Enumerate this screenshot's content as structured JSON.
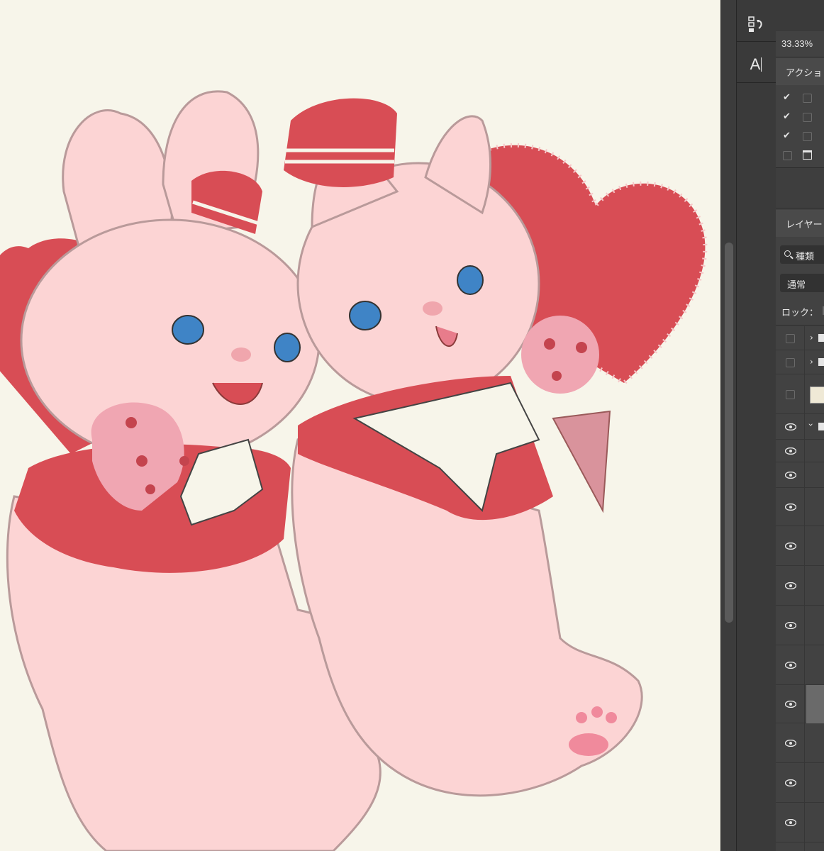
{
  "app": {
    "zoom_level": "33.33%"
  },
  "actions_panel": {
    "title": "アクショ",
    "items": [
      {
        "checked": true
      },
      {
        "checked": true
      },
      {
        "checked": true
      },
      {
        "checked": false
      }
    ]
  },
  "layers_panel": {
    "title": "レイヤー",
    "filter_label": "種類",
    "blend_mode": "通常",
    "lock_label": "ロック：",
    "layers": [
      {
        "visible": false,
        "kind": "group",
        "expanded": false
      },
      {
        "visible": false,
        "kind": "group",
        "expanded": false
      },
      {
        "visible": false,
        "kind": "image-thumbnail"
      },
      {
        "visible": true,
        "kind": "group",
        "expanded": true
      },
      {
        "visible": true,
        "kind": "layer"
      },
      {
        "visible": true,
        "kind": "layer"
      },
      {
        "visible": true,
        "kind": "layer"
      },
      {
        "visible": true,
        "kind": "layer"
      },
      {
        "visible": true,
        "kind": "layer"
      },
      {
        "visible": true,
        "kind": "layer"
      },
      {
        "visible": true,
        "kind": "layer"
      },
      {
        "visible": true,
        "kind": "layer",
        "selected": true
      },
      {
        "visible": true,
        "kind": "layer"
      },
      {
        "visible": true,
        "kind": "layer"
      },
      {
        "visible": true,
        "kind": "layer"
      }
    ]
  },
  "tools": [
    "type-tool-icon",
    "history-brush-icon"
  ],
  "colors": {
    "canvas_bg": "#f7f5ea",
    "fur_pink": "#fcd4d4",
    "accent_red": "#d84d55",
    "panel_bg": "#424242"
  }
}
